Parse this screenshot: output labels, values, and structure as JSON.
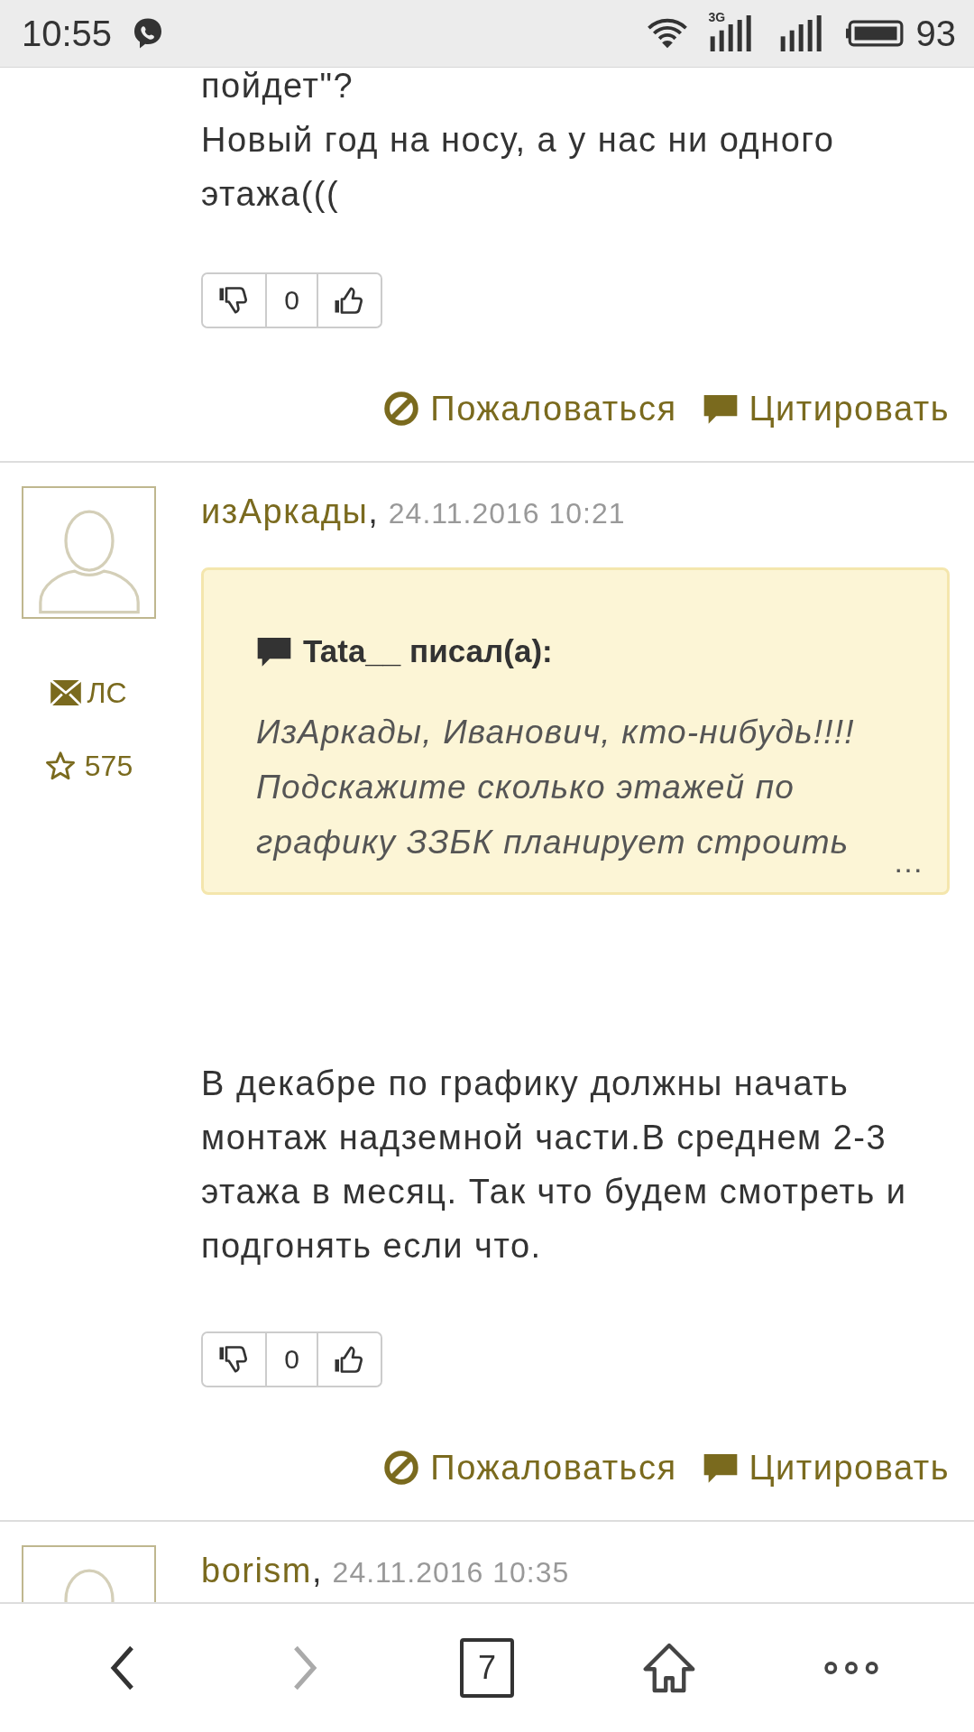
{
  "status_bar": {
    "time": "10:55",
    "network": "3G",
    "battery": "93"
  },
  "posts": [
    {
      "kind": "continued",
      "body": "пойдет\"?\nНовый год на носу, а у нас ни одного этажа(((",
      "votes": "0",
      "actions": [
        "Пожаловаться",
        "Цитировать"
      ]
    },
    {
      "kind": "full",
      "author": "изАркады",
      "separator": ",",
      "date": "24.11.2016 10:21",
      "pm": "ЛС",
      "rating": "575",
      "quote": {
        "title": "Tata__ писал(а):",
        "text": "ИзАркады, Иванович, кто-нибудь!!!! Подскажите сколько этажей по графику ЗЗБК планирует строить",
        "more": "…"
      },
      "body": "В декабре по графику должны начать монтаж надземной части.В среднем 2-3 этажа в месяц. Так что будем смотреть и подгонять если что.",
      "votes": "0",
      "actions": [
        "Пожаловаться",
        "Цитировать"
      ]
    },
    {
      "kind": "header",
      "author": "borism",
      "separator": ",",
      "date": "24.11.2016 10:35"
    }
  ],
  "nav": {
    "back_disabled": false,
    "forward_disabled": true,
    "tabs": "7"
  }
}
